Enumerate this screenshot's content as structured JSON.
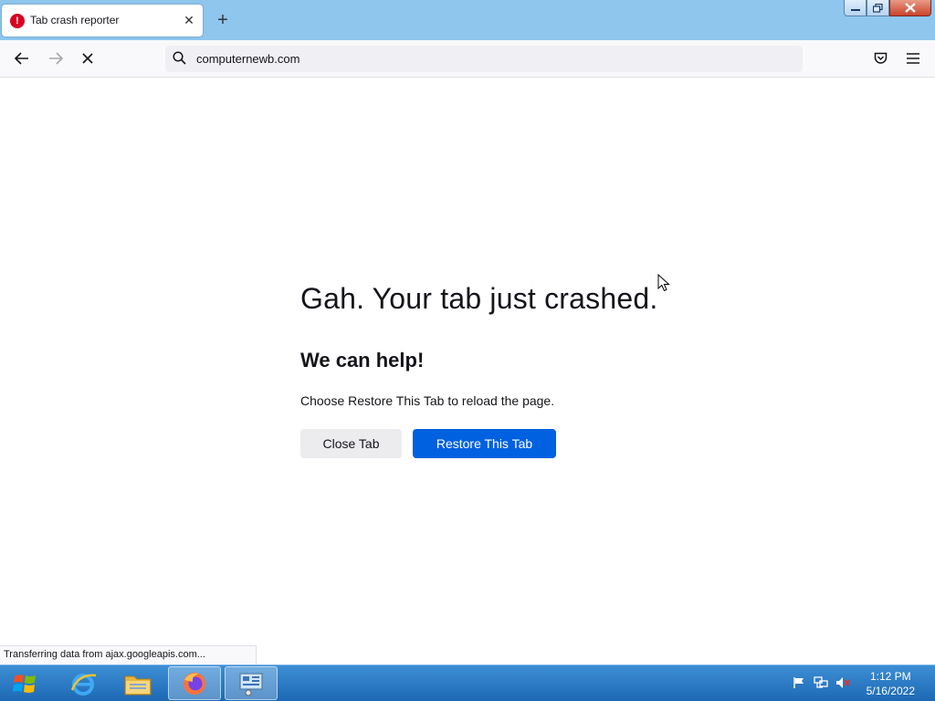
{
  "browser": {
    "tab": {
      "title": "Tab crash reporter",
      "icon": "error-icon",
      "close_glyph": "✕"
    },
    "new_tab_glyph": "+",
    "url": "computernewb.com"
  },
  "page": {
    "headline": "Gah. Your tab just crashed.",
    "subheadline": "We can help!",
    "description": "Choose Restore This Tab to reload the page.",
    "close_tab_label": "Close Tab",
    "restore_tab_label": "Restore This Tab"
  },
  "status_bar": {
    "text": "Transferring data from ajax.googleapis.com..."
  },
  "taskbar": {
    "apps": [
      "internet-explorer",
      "file-explorer",
      "firefox",
      "control-panel"
    ],
    "clock": {
      "time": "1:12 PM",
      "date": "5/16/2022"
    }
  },
  "colors": {
    "accent": "#0061e0",
    "titlebar": "#8ec6ee",
    "taskbar": "#1d69b4",
    "error": "#d70022"
  }
}
